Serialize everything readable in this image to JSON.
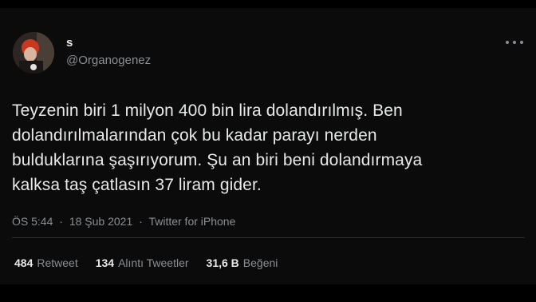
{
  "tweet": {
    "display_name": "s",
    "handle": "@Organogenez",
    "text_lines": [
      "Teyzenin biri 1 milyon 400 bin lira dolandırılmış. Ben",
      "dolandırılmalarından çok bu kadar parayı nerden",
      "bulduklarına şaşırıyorum. Şu an biri beni dolandırmaya",
      "kalksa taş çatlasın 37 liram gider."
    ],
    "time": "ÖS 5:44",
    "date": "18 Şub 2021",
    "source": "Twitter for iPhone",
    "sep": "·"
  },
  "stats": {
    "retweets_count": "484",
    "retweets_label": "Retweet",
    "quotes_count": "134",
    "quotes_label": "Alıntı Tweetler",
    "likes_count": "31,6 B",
    "likes_label": "Beğeni"
  },
  "icons": {
    "more": "more-options-icon"
  },
  "colors": {
    "background": "#000000",
    "card": "#0b0b0b",
    "text_primary": "#e7e9ea",
    "text_secondary": "#8b8f94"
  }
}
